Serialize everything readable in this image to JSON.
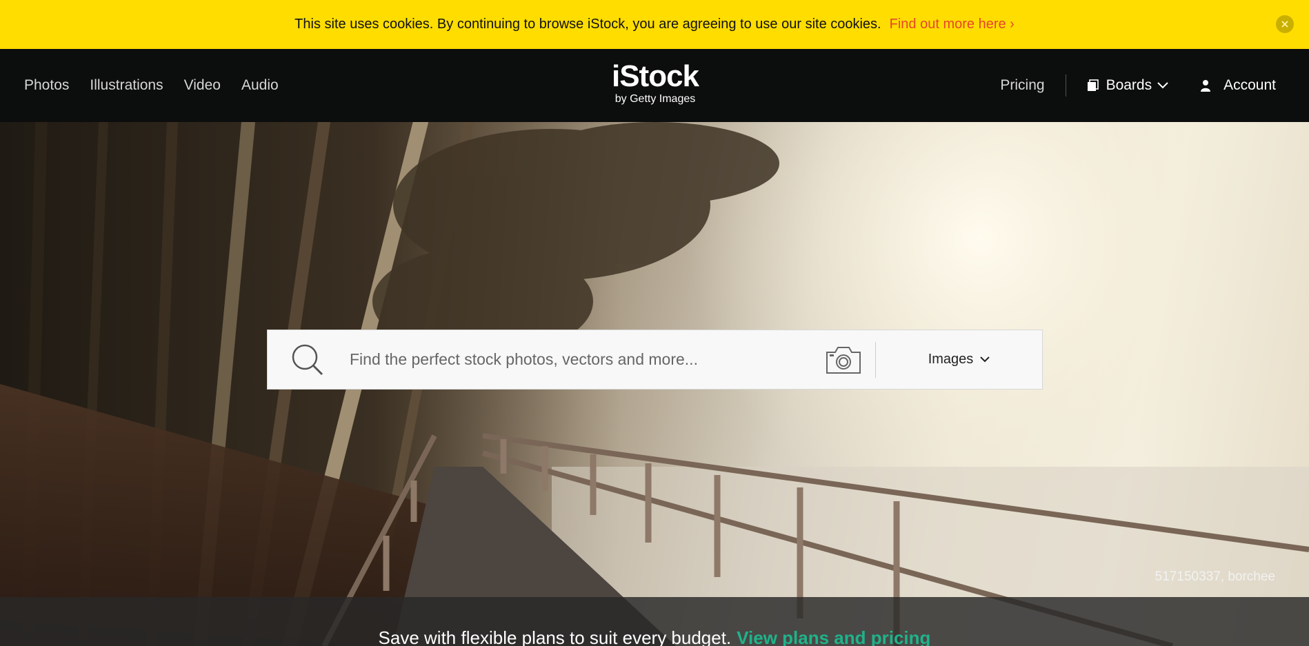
{
  "cookie_banner": {
    "message": "This site uses cookies. By continuing to browse iStock, you are agreeing to use our site cookies.",
    "link": "Find out more here ›",
    "close_icon": "close-icon"
  },
  "header": {
    "nav_left": [
      "Photos",
      "Illustrations",
      "Video",
      "Audio"
    ],
    "logo": {
      "brand": "iStock",
      "sub": "by Getty Images"
    },
    "pricing": "Pricing",
    "boards": "Boards",
    "account": "Account"
  },
  "search": {
    "placeholder": "Find the perfect stock photos, vectors and more...",
    "value": "",
    "type_label": "Images",
    "search_icon": "search-icon",
    "camera_icon": "camera-icon"
  },
  "hero": {
    "credit": "517150337, borchee"
  },
  "promo": {
    "text": "Save with flexible plans to suit every budget.",
    "link": "View plans and pricing"
  },
  "colors": {
    "cookie_bg": "#ffdd00",
    "cookie_link": "#e6452b",
    "header_bg": "#0c0d0d",
    "promo_link": "#1fb38a"
  }
}
